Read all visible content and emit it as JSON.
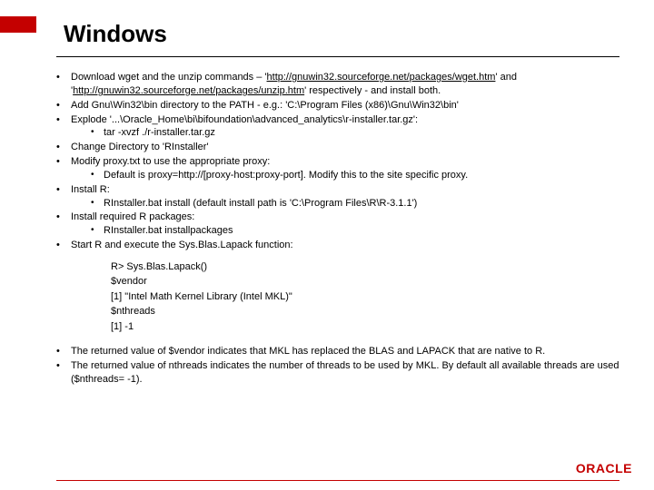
{
  "title": "Windows",
  "bullets": [
    {
      "parts": [
        {
          "t": "Download wget and the unzip commands – '"
        },
        {
          "t": "http://gnuwin32.sourceforge.net/packages/wget.htm",
          "link": true
        },
        {
          "t": "' and '"
        },
        {
          "t": "http://gnuwin32.sourceforge.net/packages/unzip.htm",
          "link": true
        },
        {
          "t": "' respectively - and install both."
        }
      ]
    },
    {
      "parts": [
        {
          "t": "Add Gnu\\Win32\\bin directory to the PATH - e.g.: 'C:\\Program Files (x86)\\Gnu\\Win32\\bin'"
        }
      ]
    },
    {
      "parts": [
        {
          "t": "Explode '...\\Oracle_Home\\bi\\bifoundation\\advanced_analytics\\r-installer.tar.gz':"
        }
      ],
      "sub": [
        "tar -xvzf ./r-installer.tar.gz"
      ]
    },
    {
      "parts": [
        {
          "t": "Change Directory to 'RInstaller'"
        }
      ]
    },
    {
      "parts": [
        {
          "t": "Modify proxy.txt to use the appropriate proxy:"
        }
      ],
      "sub": [
        "Default is proxy=http://[proxy-host:proxy-port]. Modify this to the site specific proxy."
      ]
    },
    {
      "parts": [
        {
          "t": "Install R:"
        }
      ],
      "sub": [
        "RInstaller.bat install (default install path is 'C:\\Program Files\\R\\R-3.1.1')"
      ]
    },
    {
      "parts": [
        {
          "t": "Install required R packages:"
        }
      ],
      "sub": [
        "RInstaller.bat installpackages"
      ]
    },
    {
      "parts": [
        {
          "t": "Start R and execute the Sys.Blas.Lapack function:"
        }
      ]
    }
  ],
  "code": [
    "R> Sys.Blas.Lapack()",
    "$vendor",
    "[1] \"Intel Math Kernel Library (Intel MKL)\"",
    "$nthreads",
    "[1] -1"
  ],
  "footerBullets": [
    "The returned value of $vendor indicates that MKL has replaced the BLAS and LAPACK that are native to R.",
    "The returned value of nthreads indicates the number of threads to be used by MKL. By default all available threads are used ($nthreads= -1)."
  ],
  "brand": "ORACLE"
}
